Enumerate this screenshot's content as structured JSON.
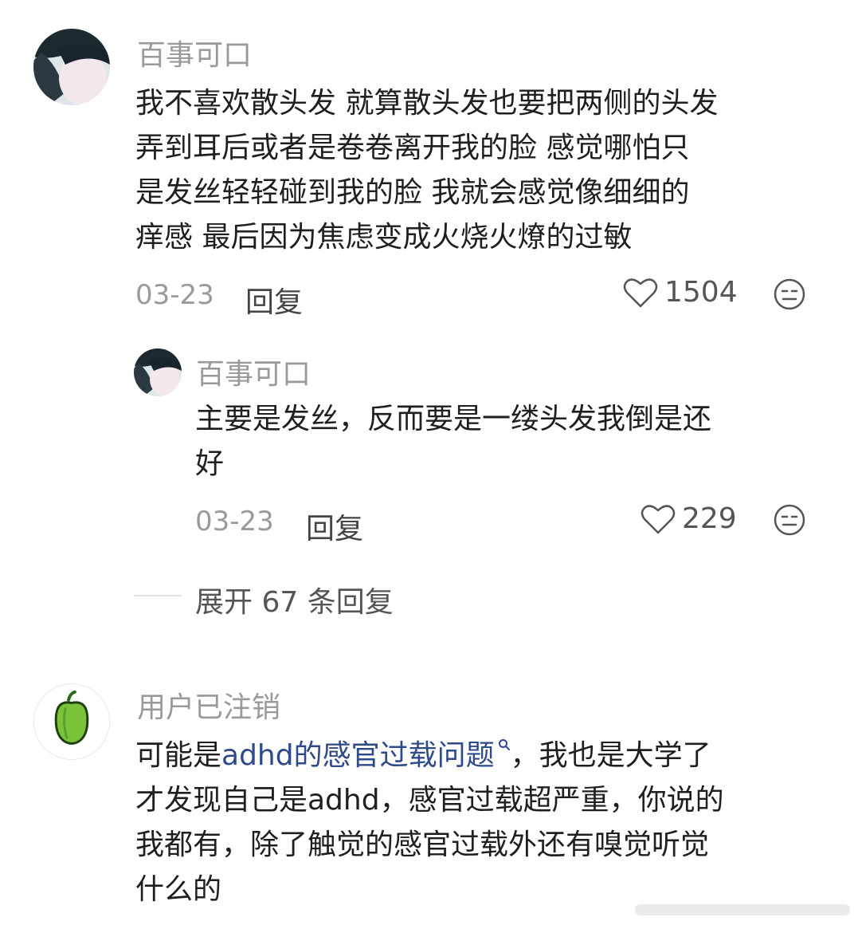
{
  "comment1": {
    "username": "百事可口",
    "lines": [
      "我不喜欢散头发 就算散头发也要把两侧的头发",
      "弄到耳后或者是卷卷离开我的脸  感觉哪怕只",
      "是发丝轻轻碰到我的脸  我就会感觉像细细的",
      "痒感  最后因为焦虑变成火烧火燎的过敏"
    ],
    "date": "03-23",
    "reply_label": "回复",
    "likes": "1504"
  },
  "reply1": {
    "username": "百事可口",
    "lines": [
      "主要是发丝，反而要是一缕头发我倒是还",
      "好"
    ],
    "date": "03-23",
    "reply_label": "回复",
    "likes": "229"
  },
  "expand": {
    "label": "展开 67 条回复"
  },
  "comment2": {
    "username": "用户已注销",
    "line1_prefix": "可能是",
    "line1_link": "adhd的感官过载问题",
    "line1_suffix": "，我也是大学了",
    "lines": [
      "才发现自己是adhd，感官过载超严重，你说的",
      "我都有，除了触觉的感官过载外还有嗅觉听觉",
      "什么的"
    ]
  },
  "colors": {
    "link": "#2f4a8a",
    "muted": "#9a9a9a",
    "text": "#1f1f1f"
  }
}
